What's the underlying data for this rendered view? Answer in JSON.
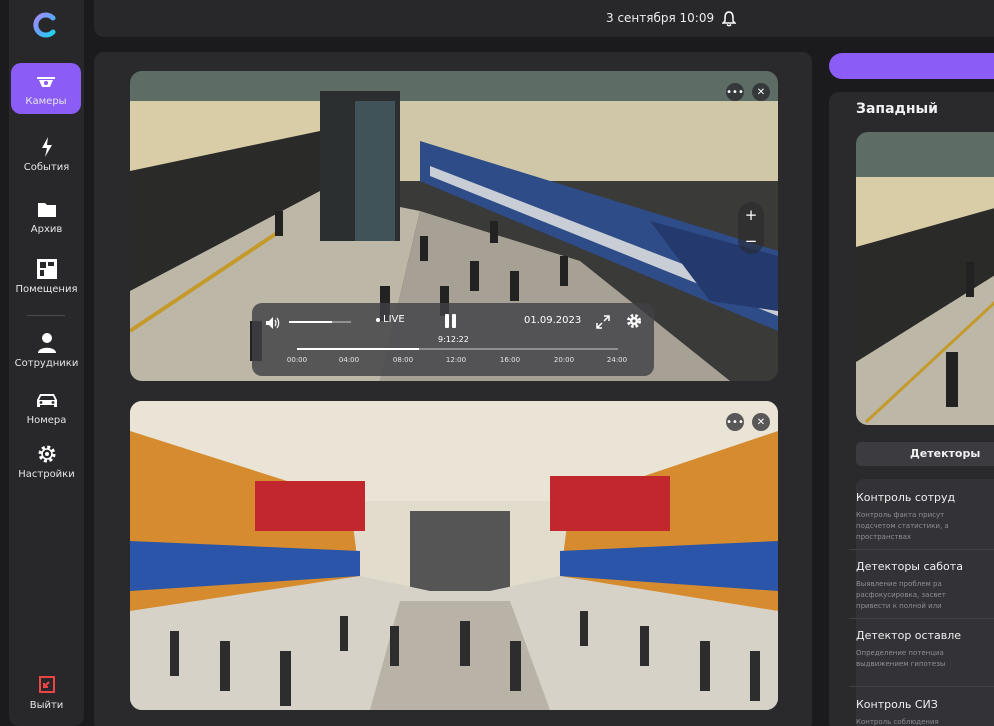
{
  "header": {
    "datetime": "3 сентября 10:09"
  },
  "sidebar": {
    "items": [
      {
        "label": "Камеры",
        "icon": "camera-icon",
        "active": true
      },
      {
        "label": "События",
        "icon": "lightning-icon"
      },
      {
        "label": "Архив",
        "icon": "folder-icon"
      },
      {
        "label": "Помещения",
        "icon": "floorplan-icon"
      },
      {
        "label": "Сотрудники",
        "icon": "person-icon"
      },
      {
        "label": "Номера",
        "icon": "car-icon"
      },
      {
        "label": "Настройки",
        "icon": "gear-icon"
      }
    ],
    "logout": "Выйти"
  },
  "player": {
    "live": "LIVE",
    "date": "01.09.2023",
    "time": "9:12:22",
    "volume": 0.7,
    "progress": 0.38,
    "ticks": [
      "00:00",
      "04:00",
      "08:00",
      "12:00",
      "16:00",
      "20:00",
      "24:00"
    ]
  },
  "right": {
    "title": "Западный",
    "detectors_button": "Детекторы",
    "detectors": [
      {
        "title": "Контроль сотруд",
        "desc": [
          "Контроль факта присут",
          "подсчетом статистики, а",
          "пространствах"
        ]
      },
      {
        "title": "Детекторы сабота",
        "desc": [
          "Выявление проблем ра",
          "расфокусировка, засвет",
          "привести к полной или"
        ]
      },
      {
        "title": "Детектор оставле",
        "desc": [
          "Определение потенциа",
          "выдвижением гипотезы"
        ]
      },
      {
        "title": "Контроль СИЗ",
        "desc": [
          "Контроль соблюдения"
        ]
      }
    ]
  },
  "colors": {
    "accent": "#8b5cf6",
    "sidebar": "#28282b",
    "panel": "#2a2a2d",
    "background": "#1b1b1d"
  }
}
